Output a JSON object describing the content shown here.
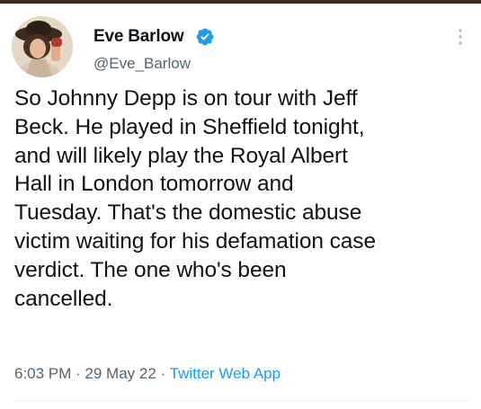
{
  "author": {
    "display_name": "Eve Barlow",
    "handle": "@Eve_Barlow",
    "verified": true,
    "avatar_icon": "profile-photo"
  },
  "tweet": {
    "lines": [
      "So Johnny Depp is on tour with Jeff",
      "Beck. He played in Sheffield tonight,",
      "and will likely play the Royal Albert",
      "Hall in London tomorrow and",
      "Tuesday. That's the domestic abuse",
      "victim waiting for his defamation case",
      "verdict. The one who's been",
      "cancelled."
    ]
  },
  "meta": {
    "time": "6:03 PM",
    "sep1": " · ",
    "date": "29 May 22",
    "sep2": " · ",
    "source": "Twitter Web App"
  },
  "colors": {
    "text": "#0f1419",
    "secondary": "#536471",
    "link": "#1d9bf0",
    "verified": "#1d9bf0"
  },
  "icons": {
    "verified": "verified-badge-icon",
    "more": "more-options-icon"
  }
}
